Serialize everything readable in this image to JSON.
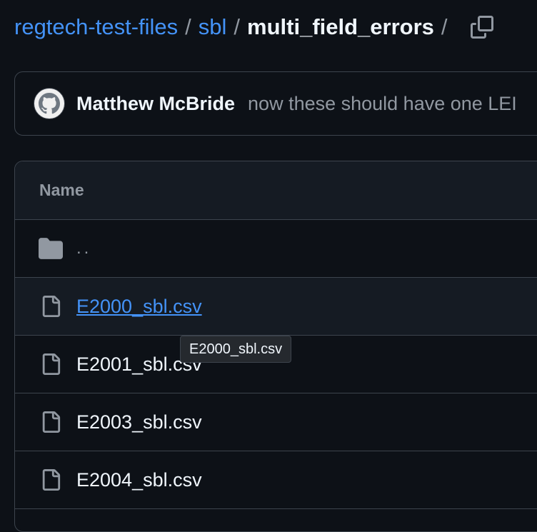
{
  "breadcrumb": {
    "repo": "regtech-test-files",
    "sep1": "/",
    "folder": "sbl",
    "sep2": "/",
    "current": "multi_field_errors",
    "sep3": "/",
    "copy_icon": "copy-icon"
  },
  "commit": {
    "avatar_icon": "github-octocat-avatar",
    "author": "Matthew McBride",
    "message": "now these should have one LEI"
  },
  "table": {
    "header": "Name",
    "parent_label": "..",
    "files": [
      {
        "name": "E2000_sbl.csv",
        "icon": "file-icon"
      },
      {
        "name": "E2001_sbl.csv",
        "icon": "file-icon"
      },
      {
        "name": "E2003_sbl.csv",
        "icon": "file-icon"
      },
      {
        "name": "E2004_sbl.csv",
        "icon": "file-icon"
      }
    ]
  },
  "tooltip": {
    "text": "E2000_sbl.csv"
  },
  "colors": {
    "background": "#0d1117",
    "link": "#4493f8",
    "border": "#3d444d",
    "muted": "#9198a1"
  }
}
